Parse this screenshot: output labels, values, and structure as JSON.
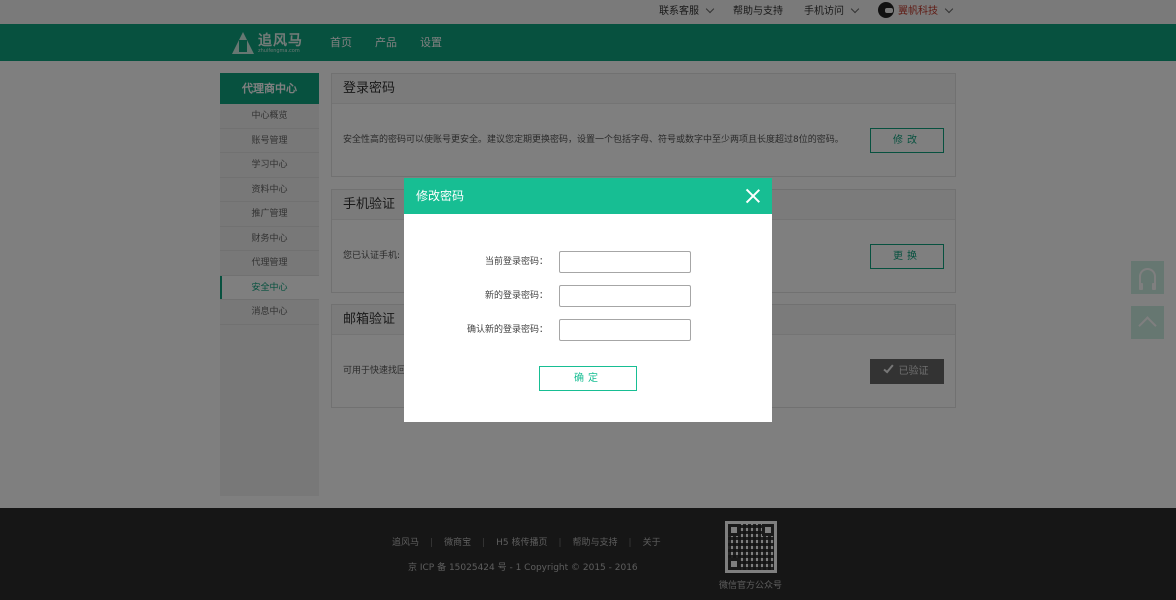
{
  "topbar": {
    "customer_service": "联系客服",
    "help": "帮助与支持",
    "mobile": "手机访问",
    "user_name": "翼帆科技"
  },
  "nav": {
    "logo_name": "追风马",
    "logo_sub": "zhuifengma.com",
    "links": [
      "首页",
      "产品",
      "设置"
    ]
  },
  "sidebar": {
    "title": "代理商中心",
    "items": [
      "中心概览",
      "账号管理",
      "学习中心",
      "资料中心",
      "推广管理",
      "财务中心",
      "代理管理",
      "安全中心",
      "消息中心"
    ],
    "active_index": 7
  },
  "panels": [
    {
      "title": "登录密码",
      "text": "安全性高的密码可以使账号更安全。建议您定期更换密码，设置一个包括字母、符号或数字中至少两项且长度超过8位的密码。",
      "button": "修改"
    },
    {
      "title": "手机验证",
      "text": "您已认证手机:",
      "button": "更换"
    },
    {
      "title": "邮箱验证",
      "text": "可用于快速找回",
      "button": "已验证"
    }
  ],
  "footer": {
    "links": [
      "追风马",
      "微商宝",
      "H5 核传播页",
      "帮助与支持",
      "关于"
    ],
    "copyright": "京 ICP 备 15025424 号 - 1    Copyright © 2015 - 2016",
    "qr_caption": "微信官方公众号"
  },
  "modal": {
    "title": "修改密码",
    "fields": [
      {
        "label": "当前登录密码：",
        "value": ""
      },
      {
        "label": "新的登录密码：",
        "value": ""
      },
      {
        "label": "确认新的登录密码：",
        "value": ""
      }
    ],
    "confirm": "确定"
  },
  "colors": {
    "brand_green": "#0ea37f",
    "modal_header": "#17be93"
  }
}
